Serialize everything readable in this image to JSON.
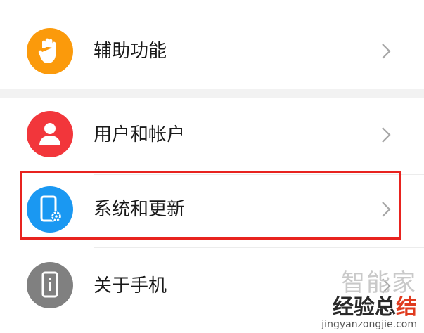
{
  "settings": {
    "items": [
      {
        "label": "辅助功能",
        "icon": "hand-icon",
        "color": "#fb9a0b"
      },
      {
        "label": "用户和帐户",
        "icon": "user-icon",
        "color": "#f2363b"
      },
      {
        "label": "系统和更新",
        "icon": "phone-settings-icon",
        "color": "#1a98f2"
      },
      {
        "label": "关于手机",
        "icon": "phone-info-icon",
        "color": "#808080"
      }
    ]
  },
  "watermark": {
    "top_text": "智能家",
    "main_text_a": "经验总",
    "main_text_b": "结",
    "url": "jingyanzongjie.com"
  },
  "colors": {
    "highlight": "#e8231f",
    "chevron": "#a6a6a6"
  }
}
